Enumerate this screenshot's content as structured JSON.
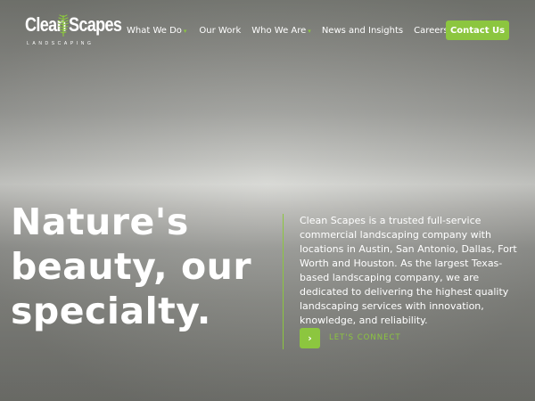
{
  "brand": {
    "word1": "Clean",
    "word2": "Scapes",
    "tagline": "LANDSCAPING",
    "accent_color": "#8cc63f"
  },
  "nav": {
    "items": [
      {
        "label": "What We Do",
        "has_dropdown": true
      },
      {
        "label": "Our Work",
        "has_dropdown": false
      },
      {
        "label": "Who We Are",
        "has_dropdown": true
      },
      {
        "label": "News and Insights",
        "has_dropdown": false
      },
      {
        "label": "Careers",
        "has_dropdown": true
      }
    ],
    "dropdown_icon": "chevron-down-icon",
    "contact_label": "Contact Us"
  },
  "hero": {
    "title_lines": [
      "Nature's",
      "beauty, our",
      "specialty."
    ],
    "description": "Clean Scapes is a trusted full-service commercial landscaping company with locations in Austin, San Antonio, Dallas, Fort Worth and Houston. As the largest Texas-based landscaping company, we are dedicated to delivering the highest quality landscaping services with innovation, knowledge, and reliability.",
    "cta_icon": "chevron-right-icon",
    "cta_label": "LET'S CONNECT"
  }
}
